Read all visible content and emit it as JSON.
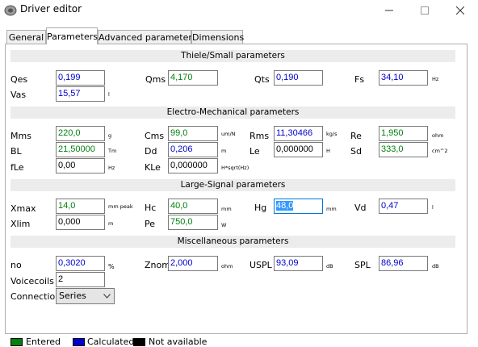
{
  "window": {
    "title": "Driver editor",
    "minimize": "—",
    "maximize": "☐",
    "close": "✕"
  },
  "tabs": [
    "General",
    "Parameters",
    "Advanced parameters",
    "Dimensions"
  ],
  "sections": {
    "ts": "Thiele/Small parameters",
    "em": "Electro-Mechanical parameters",
    "ls": "Large-Signal parameters",
    "misc": "Miscellaneous parameters"
  },
  "fields": {
    "qes": {
      "label": "Qes",
      "value": "0,199",
      "unit": ""
    },
    "qms": {
      "label": "Qms",
      "value": "4,170",
      "unit": ""
    },
    "qts": {
      "label": "Qts",
      "value": "0,190",
      "unit": ""
    },
    "fs": {
      "label": "Fs",
      "value": "34,10",
      "unit": "Hz"
    },
    "vas": {
      "label": "Vas",
      "value": "15,57",
      "unit": "l"
    },
    "mms": {
      "label": "Mms",
      "value": "220,0",
      "unit": "g"
    },
    "cms": {
      "label": "Cms",
      "value": "99,0",
      "unit": "um/N"
    },
    "rms": {
      "label": "Rms",
      "value": "11,30466",
      "unit": "kg/s"
    },
    "re": {
      "label": "Re",
      "value": "1,950",
      "unit": "ohm"
    },
    "bl": {
      "label": "BL",
      "value": "21,50000",
      "unit": "Tm"
    },
    "dd": {
      "label": "Dd",
      "value": "0,206",
      "unit": "m"
    },
    "le": {
      "label": "Le",
      "value": "0,000000",
      "unit": "H"
    },
    "sd": {
      "label": "Sd",
      "value": "333,0",
      "unit": "cm^2"
    },
    "fle": {
      "label": "fLe",
      "value": "0,00",
      "unit": "Hz"
    },
    "kle": {
      "label": "KLe",
      "value": "0,000000",
      "unit": "H*sqrt(Hz)"
    },
    "xmax": {
      "label": "Xmax",
      "value": "14,0",
      "unit": "mm  peak"
    },
    "hc": {
      "label": "Hc",
      "value": "40,0",
      "unit": "mm"
    },
    "hg": {
      "label": "Hg",
      "value": "48,0",
      "unit": "mm"
    },
    "vd": {
      "label": "Vd",
      "value": "0,47",
      "unit": "l"
    },
    "xlim": {
      "label": "Xlim",
      "value": "0,000",
      "unit": "m"
    },
    "pe": {
      "label": "Pe",
      "value": "750,0",
      "unit": "W"
    },
    "no": {
      "label": "no",
      "value": "0,3020",
      "unit": "%"
    },
    "znom": {
      "label": "Znom",
      "value": "2,000",
      "unit": "ohm"
    },
    "uspl": {
      "label": "USPL",
      "value": "93,09",
      "unit": "dB"
    },
    "spl": {
      "label": "SPL",
      "value": "86,96",
      "unit": "dB"
    },
    "voicecoils": {
      "label": "Voicecoils",
      "value": "2"
    }
  },
  "connection": {
    "label": "Connection",
    "value": "Series"
  },
  "legend": [
    {
      "label": "Entered",
      "color": "#00800f"
    },
    {
      "label": "Calculated",
      "color": "#0000cc"
    },
    {
      "label": "Not available",
      "color": "#000000"
    }
  ]
}
